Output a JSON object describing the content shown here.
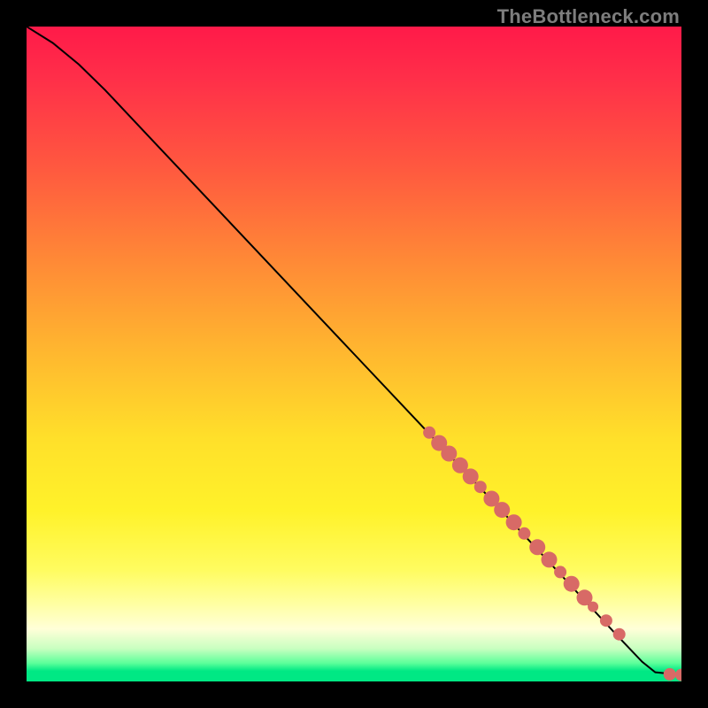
{
  "attribution": "TheBottleneck.com",
  "colors": {
    "point": "#d86a66",
    "line": "#000000",
    "gradient_top": "#ff1a49",
    "gradient_bottom": "#00e884"
  },
  "chart_data": {
    "type": "line",
    "title": "",
    "xlabel": "",
    "ylabel": "",
    "xlim": [
      0,
      100
    ],
    "ylim": [
      0,
      100
    ],
    "grid": false,
    "curve": [
      {
        "x": 0,
        "y": 100
      },
      {
        "x": 4,
        "y": 97.5
      },
      {
        "x": 8,
        "y": 94.2
      },
      {
        "x": 12,
        "y": 90.3
      },
      {
        "x": 20,
        "y": 81.8
      },
      {
        "x": 30,
        "y": 71.2
      },
      {
        "x": 40,
        "y": 60.6
      },
      {
        "x": 50,
        "y": 50.0
      },
      {
        "x": 60,
        "y": 39.4
      },
      {
        "x": 70,
        "y": 28.8
      },
      {
        "x": 80,
        "y": 18.0
      },
      {
        "x": 90,
        "y": 7.2
      },
      {
        "x": 94,
        "y": 3.0
      },
      {
        "x": 96,
        "y": 1.4
      },
      {
        "x": 100,
        "y": 1.0
      }
    ],
    "series": [
      {
        "name": "points",
        "color": "#d86a66",
        "data": [
          {
            "x": 61.5,
            "y": 38.0,
            "r": 7
          },
          {
            "x": 63.0,
            "y": 36.4,
            "r": 9
          },
          {
            "x": 64.5,
            "y": 34.8,
            "r": 9
          },
          {
            "x": 66.2,
            "y": 33.0,
            "r": 9
          },
          {
            "x": 67.8,
            "y": 31.3,
            "r": 9
          },
          {
            "x": 69.3,
            "y": 29.7,
            "r": 7
          },
          {
            "x": 71.0,
            "y": 27.9,
            "r": 9
          },
          {
            "x": 72.6,
            "y": 26.2,
            "r": 9
          },
          {
            "x": 74.4,
            "y": 24.3,
            "r": 9
          },
          {
            "x": 76.0,
            "y": 22.6,
            "r": 7
          },
          {
            "x": 78.0,
            "y": 20.5,
            "r": 9
          },
          {
            "x": 79.8,
            "y": 18.6,
            "r": 9
          },
          {
            "x": 81.5,
            "y": 16.7,
            "r": 7
          },
          {
            "x": 83.2,
            "y": 14.9,
            "r": 9
          },
          {
            "x": 85.2,
            "y": 12.8,
            "r": 9
          },
          {
            "x": 86.5,
            "y": 11.4,
            "r": 6
          },
          {
            "x": 88.5,
            "y": 9.3,
            "r": 7
          },
          {
            "x": 90.5,
            "y": 7.2,
            "r": 7
          },
          {
            "x": 98.2,
            "y": 1.1,
            "r": 7
          },
          {
            "x": 100.0,
            "y": 1.0,
            "r": 7
          }
        ]
      }
    ]
  }
}
